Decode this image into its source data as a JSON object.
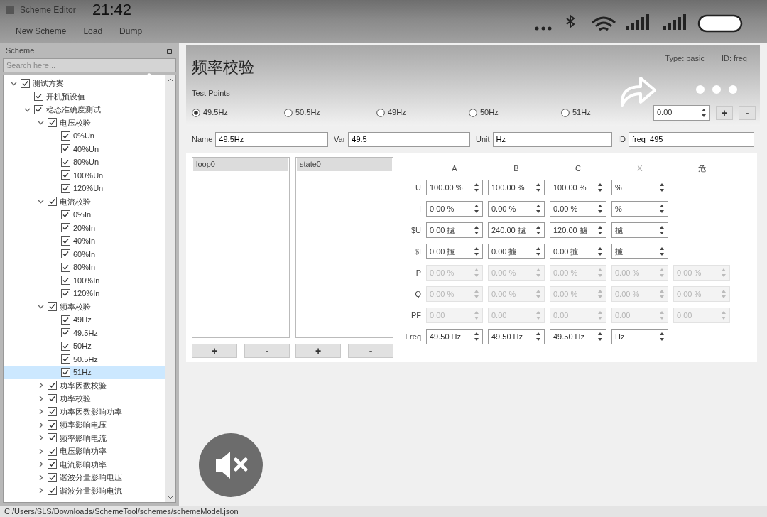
{
  "window": {
    "title": "Scheme Editor"
  },
  "menu": [
    "New Scheme",
    "Load",
    "Dump"
  ],
  "overlay": {
    "time": "21:42"
  },
  "sidebar": {
    "title": "Scheme",
    "search": {
      "placeholder": "Search here..."
    },
    "tree": [
      {
        "label": "测试方案",
        "checked": true,
        "expanded": true,
        "selected": false,
        "children": [
          {
            "label": "开机预设值",
            "checked": true,
            "selected": false
          },
          {
            "label": "稳态准确度测试",
            "checked": true,
            "expanded": true,
            "selected": false,
            "children": [
              {
                "label": "电压校验",
                "checked": true,
                "expanded": true,
                "selected": false,
                "children": [
                  {
                    "label": "0%Un",
                    "checked": true,
                    "selected": false
                  },
                  {
                    "label": "40%Un",
                    "checked": true,
                    "selected": false
                  },
                  {
                    "label": "80%Un",
                    "checked": true,
                    "selected": false
                  },
                  {
                    "label": "100%Un",
                    "checked": true,
                    "selected": false
                  },
                  {
                    "label": "120%Un",
                    "checked": true,
                    "selected": false
                  }
                ]
              },
              {
                "label": "电流校验",
                "checked": true,
                "expanded": true,
                "selected": false,
                "children": [
                  {
                    "label": "0%In",
                    "checked": true,
                    "selected": false
                  },
                  {
                    "label": "20%In",
                    "checked": true,
                    "selected": false
                  },
                  {
                    "label": "40%In",
                    "checked": true,
                    "selected": false
                  },
                  {
                    "label": "60%In",
                    "checked": true,
                    "selected": false
                  },
                  {
                    "label": "80%In",
                    "checked": true,
                    "selected": false
                  },
                  {
                    "label": "100%In",
                    "checked": true,
                    "selected": false
                  },
                  {
                    "label": "120%In",
                    "checked": true,
                    "selected": false
                  }
                ]
              },
              {
                "label": "频率校验",
                "checked": true,
                "expanded": true,
                "selected": false,
                "children": [
                  {
                    "label": "49Hz",
                    "checked": true,
                    "selected": false
                  },
                  {
                    "label": "49.5Hz",
                    "checked": true,
                    "selected": false
                  },
                  {
                    "label": "50Hz",
                    "checked": true,
                    "selected": false
                  },
                  {
                    "label": "50.5Hz",
                    "checked": true,
                    "selected": false
                  },
                  {
                    "label": "51Hz",
                    "checked": true,
                    "selected": true
                  }
                ]
              },
              {
                "label": "功率因数校验",
                "checked": true,
                "expanded": false,
                "selected": false
              },
              {
                "label": "功率校验",
                "checked": true,
                "expanded": false,
                "selected": false
              },
              {
                "label": "功率因数影响功率",
                "checked": true,
                "expanded": false,
                "selected": false
              },
              {
                "label": "频率影响电压",
                "checked": true,
                "expanded": false,
                "selected": false
              },
              {
                "label": "频率影响电流",
                "checked": true,
                "expanded": false,
                "selected": false
              },
              {
                "label": "电压影响功率",
                "checked": true,
                "expanded": false,
                "selected": false
              },
              {
                "label": "电流影响功率",
                "checked": true,
                "expanded": false,
                "selected": false
              },
              {
                "label": "谐波分量影响电压",
                "checked": true,
                "expanded": false,
                "selected": false
              },
              {
                "label": "谐波分量影响电流",
                "checked": true,
                "expanded": false,
                "selected": false
              }
            ]
          }
        ]
      }
    ]
  },
  "header": {
    "title": "频率校验",
    "type": "Type: basic",
    "id": "ID: freq"
  },
  "test_points": {
    "label": "Test Points",
    "items": [
      {
        "label": "49.5Hz",
        "selected": true
      },
      {
        "label": "50.5Hz",
        "selected": false
      },
      {
        "label": "49Hz",
        "selected": false
      },
      {
        "label": "50Hz",
        "selected": false
      },
      {
        "label": "51Hz",
        "selected": false
      }
    ],
    "spin_value": "0.00",
    "add": "+",
    "remove": "-"
  },
  "fields": [
    {
      "label": "Name",
      "value": "49.5Hz"
    },
    {
      "label": "Var",
      "value": "49.5"
    },
    {
      "label": "Unit",
      "value": "Hz"
    },
    {
      "label": "ID",
      "value": "freq_495"
    }
  ],
  "lists": [
    {
      "items": [
        {
          "label": "loop0",
          "selected": true
        }
      ],
      "add": "+",
      "remove": "-"
    },
    {
      "items": [
        {
          "label": "state0",
          "selected": true
        }
      ],
      "add": "+",
      "remove": "-"
    }
  ],
  "table": {
    "columns": [
      {
        "label": "A",
        "disabled": false
      },
      {
        "label": "B",
        "disabled": false
      },
      {
        "label": "C",
        "disabled": false
      },
      {
        "label": "X",
        "disabled": true
      },
      {
        "label": "危",
        "disabled": false
      }
    ],
    "rows": [
      {
        "label": "U",
        "disabled": false,
        "cells": [
          "100.00 %",
          "100.00 %",
          "100.00 %",
          "%"
        ]
      },
      {
        "label": "I",
        "disabled": false,
        "cells": [
          "0.00 %",
          "0.00 %",
          "0.00 %",
          "%"
        ]
      },
      {
        "label": "$U",
        "disabled": false,
        "cells": [
          "0.00 攄",
          "240.00 攄",
          "120.00 攄",
          "攄"
        ]
      },
      {
        "label": "$I",
        "disabled": false,
        "cells": [
          "0.00 攄",
          "0.00 攄",
          "0.00 攄",
          "攄"
        ]
      },
      {
        "label": "P",
        "disabled": true,
        "cells": [
          "0.00 %",
          "0.00 %",
          "0.00 %",
          "0.00 %",
          "0.00 %"
        ]
      },
      {
        "label": "Q",
        "disabled": true,
        "cells": [
          "0.00 %",
          "0.00 %",
          "0.00 %",
          "0.00 %",
          "0.00 %"
        ]
      },
      {
        "label": "PF",
        "disabled": true,
        "cells": [
          "0.00",
          "0.00",
          "0.00",
          "0.00",
          "0.00"
        ]
      },
      {
        "label": "Freq",
        "disabled": false,
        "cells": [
          "49.50 Hz",
          "49.50 Hz",
          "49.50 Hz",
          "Hz"
        ]
      }
    ]
  },
  "status_bar": "C:/Users/SLS/Downloads/SchemeTool/schemes/schemeModel.json"
}
